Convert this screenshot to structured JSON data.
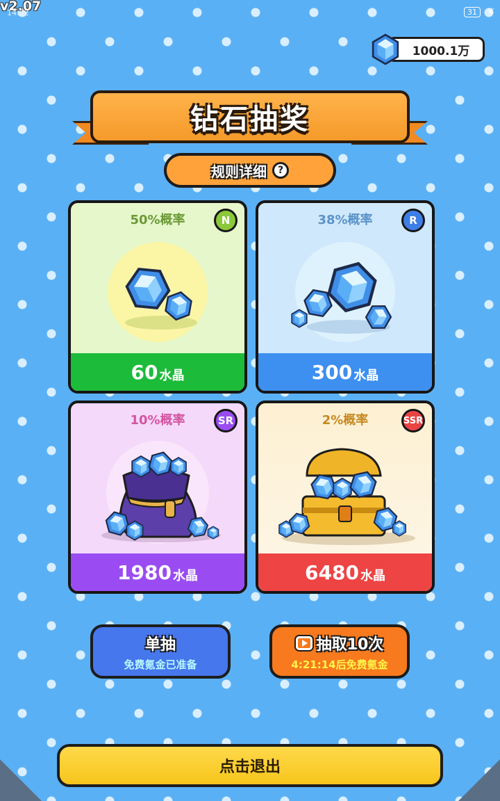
{
  "status": {
    "version": "v2.07",
    "time": "14:22",
    "battery": "31"
  },
  "currency": {
    "amount": "1000.1万",
    "icon": "blue-diamond-icon"
  },
  "title": "钻石抽奖",
  "rules": {
    "label": "规则详细",
    "icon": "question-icon"
  },
  "cards": [
    {
      "probability": "50%概率",
      "rarity": "N",
      "amount": "60",
      "unit": "水晶",
      "art": "two-diamonds"
    },
    {
      "probability": "38%概率",
      "rarity": "R",
      "amount": "300",
      "unit": "水晶",
      "art": "diamond-pile"
    },
    {
      "probability": "10%概率",
      "rarity": "SR",
      "amount": "1980",
      "unit": "水晶",
      "art": "diamond-bag"
    },
    {
      "probability": "2%概率",
      "rarity": "SSR",
      "amount": "6480",
      "unit": "水晶",
      "art": "treasure-chest"
    }
  ],
  "buttons": {
    "single": {
      "label": "单抽",
      "sub": "免费氪金已准备"
    },
    "ten": {
      "label": "抽取10次",
      "sub": "4:21:14后免费氪金",
      "icon": "video-icon"
    },
    "exit": {
      "label": "点击退出"
    }
  },
  "colors": {
    "background": "#5ab0f4",
    "banner": "#f59a2a",
    "n_bar": "#1dbb3a",
    "r_bar": "#3d8ff0",
    "sr_bar": "#9a4cf2",
    "ssr_bar": "#ee4444",
    "exit_button": "#f7c51c"
  }
}
